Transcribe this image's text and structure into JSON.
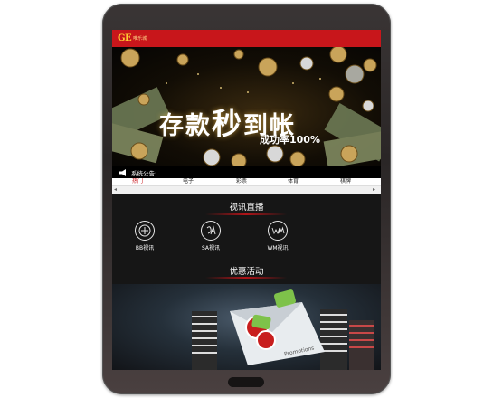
{
  "header": {
    "logo_mark": "GE",
    "logo_text": "唯乐城"
  },
  "banner": {
    "headline_pre": "存款",
    "headline_big": "秒",
    "headline_post": "到帐",
    "subline": "成功率100%"
  },
  "notice": {
    "label": "系统公告:"
  },
  "nav": {
    "items": [
      "热门",
      "电子",
      "彩票",
      "体育",
      "棋牌"
    ]
  },
  "live_section": {
    "title": "视讯直播",
    "items": [
      {
        "label": "BB视讯",
        "icon": "bb-logo-icon"
      },
      {
        "label": "SA视讯",
        "icon": "sa-logo-icon"
      },
      {
        "label": "WM视讯",
        "icon": "wm-logo-icon"
      }
    ]
  },
  "promo_section": {
    "title": "优惠活动",
    "envelope_text": "Promotions"
  },
  "colors": {
    "topbar": "#c8161b",
    "screen_bg": "#161616",
    "accent_line": "#b01418"
  }
}
